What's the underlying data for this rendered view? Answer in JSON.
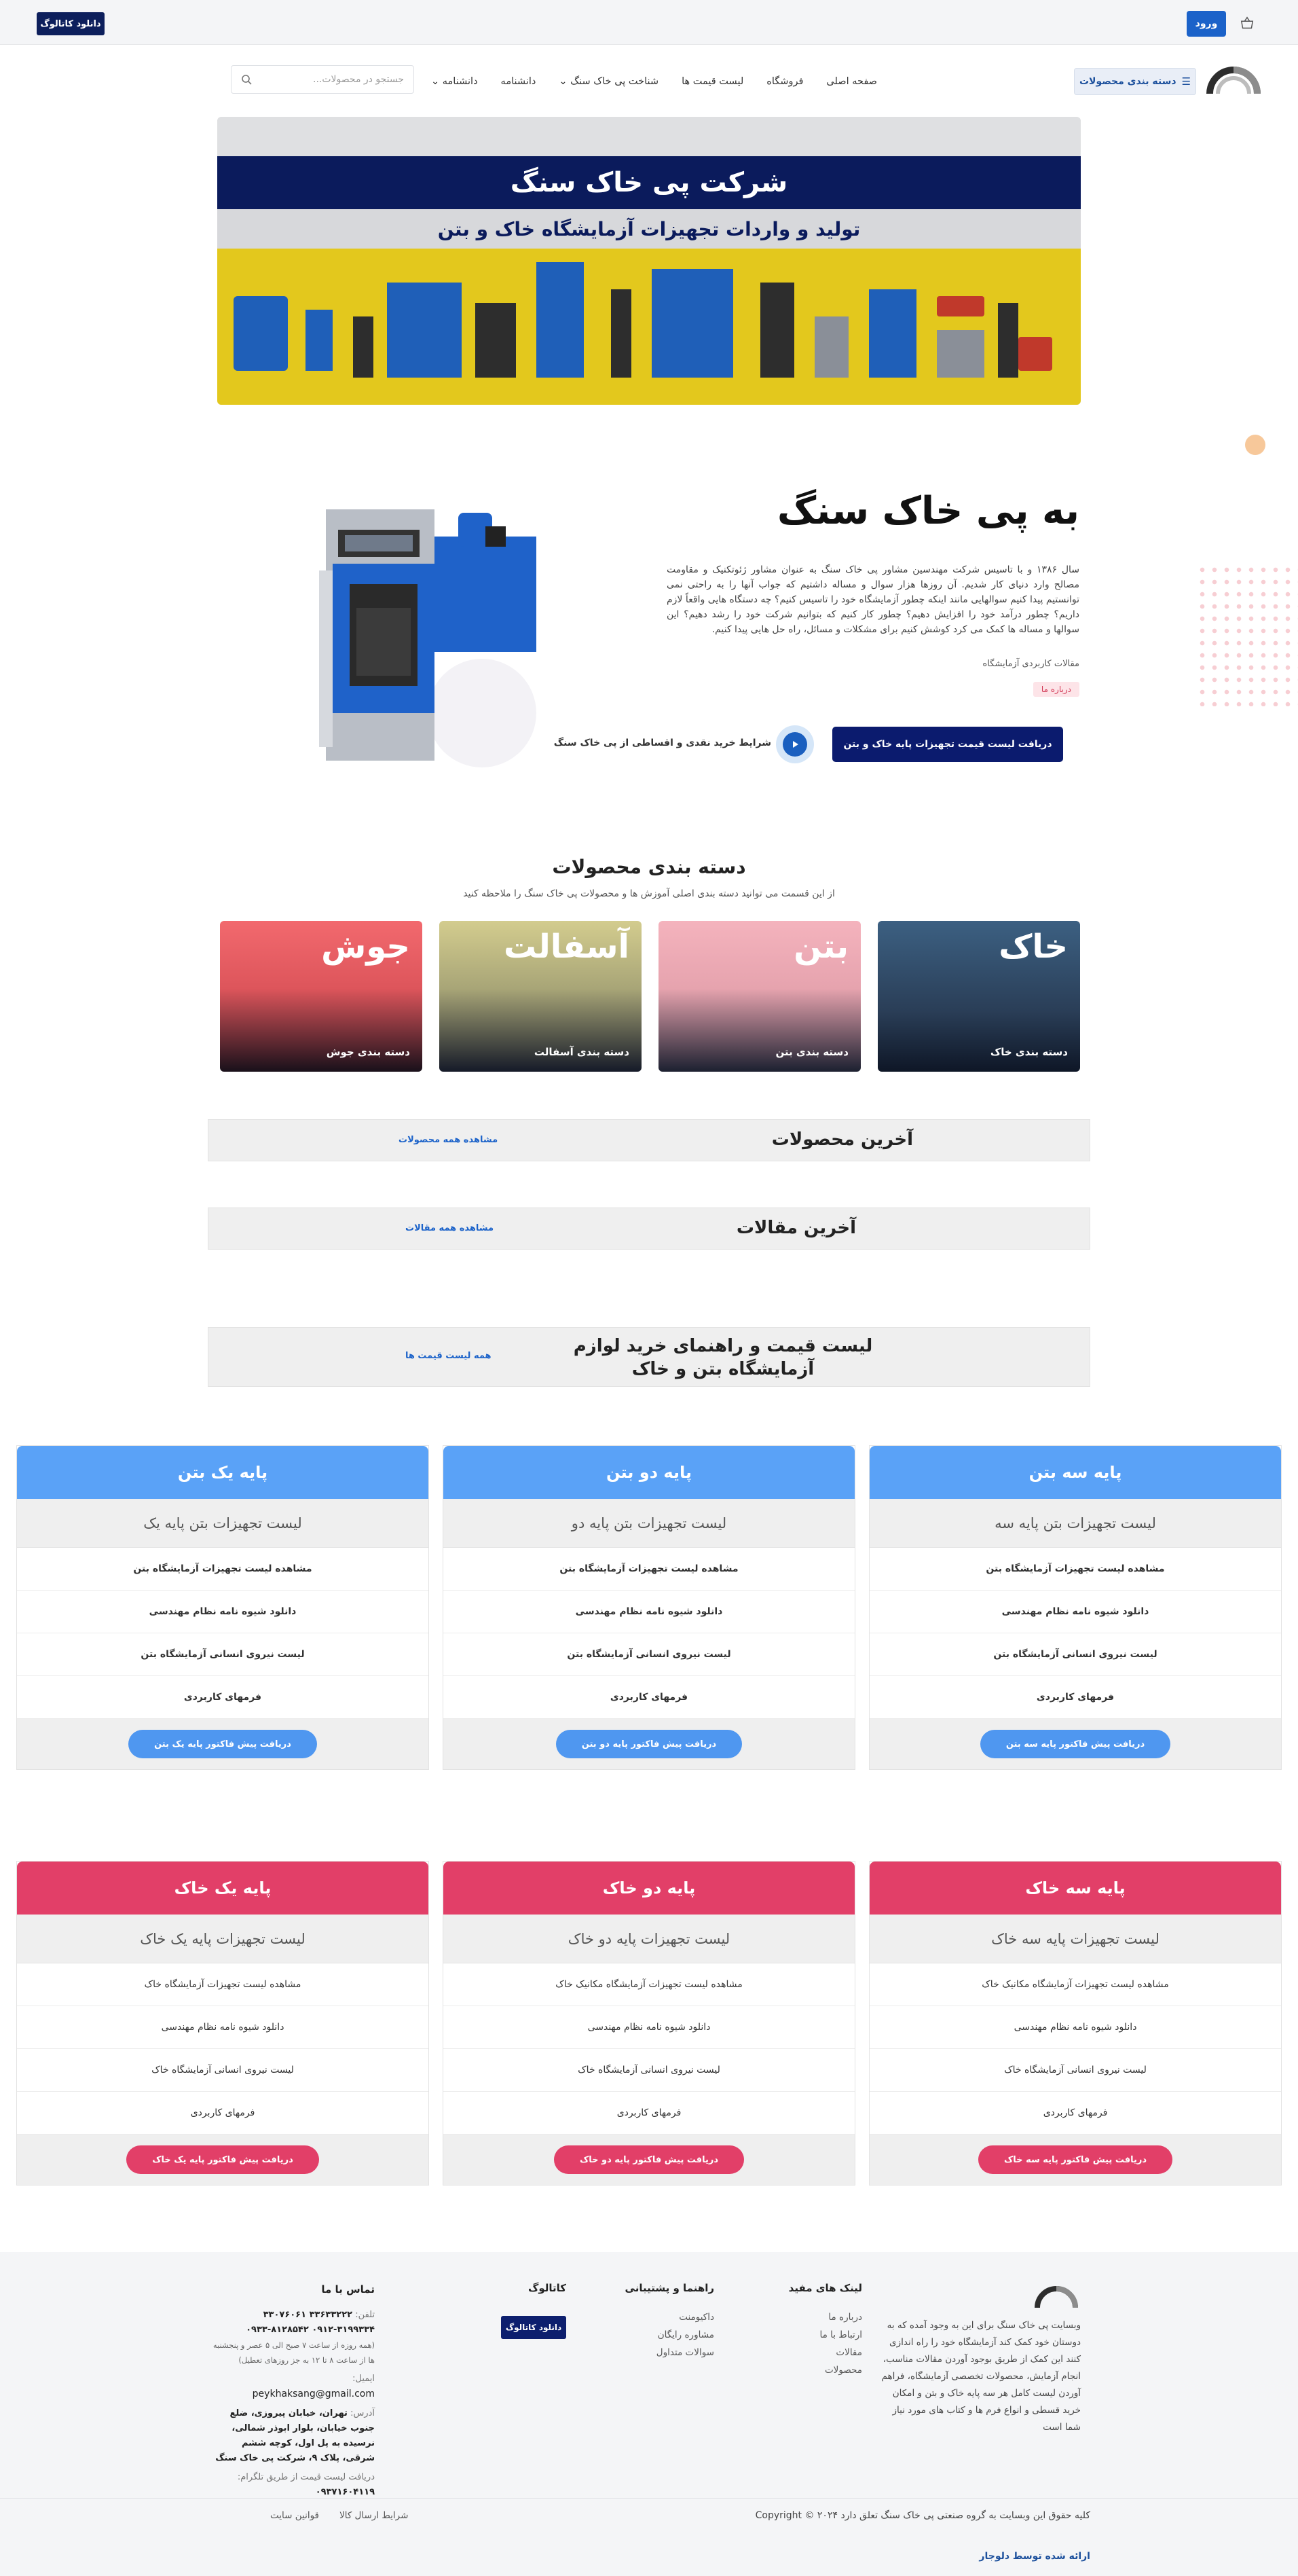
{
  "topbar": {
    "catalog_button": "دانلود کاتالوگ",
    "login_button": "ورود"
  },
  "nav": {
    "categories_button": "دسته بندی محصولات",
    "menu": [
      "صفحه اصلی",
      "فروشگاه",
      "لیست قیمت ها",
      "شناخت پی خاک سنگ",
      "دانشنامه",
      "دانشنامه"
    ],
    "search_placeholder": "جستجو در محصولات..."
  },
  "banner": {
    "title": "شرکت پی خاک سنگ",
    "subtitle": "تولید و واردات تجهیزات آزمایشگاه خاک و بتن"
  },
  "about": {
    "title": "به پی خاک سنگ",
    "text": "سال ۱۳۸۶ و با تاسیس شرکت مهندسین مشاور پی خاک سنگ به عنوان مشاور ژئوتکنیک و مقاومت مصالح وارد دنیای کار شدیم. آن روزها هزار سوال و مساله داشتیم که جواب آنها را به راحتی نمی توانستیم پیدا کنیم سوالهایی مانند اینکه چطور آزمایشگاه خود را تاسیس کنیم؟ چه دستگاه هایی واقعاً لازم داریم؟ چطور درآمد خود را افزایش دهیم؟ چطور کار کنیم که بتوانیم شرکت خود را رشد دهیم؟ این سوالها و مساله ها کمک می کرد کوشش کنیم برای مشکلات و مسائل، راه حل هایی پیدا کنیم.",
    "link": "مقالات کاربردی آزمایشگاه",
    "badge": "درباره ما",
    "price_button": "دریافت لیست قیمت تجهیزات پایه خاک و بتن",
    "terms_text": "شرایط خرید نقدی و اقساطی از پی خاک سنگ"
  },
  "categories": {
    "title": "دسته بندی محصولات",
    "subtitle": "از این قسمت می توانید دسته بندی اصلی آموزش ها و محصولات پی خاک سنگ را ملاحظه کنید",
    "items": [
      {
        "big": "خاک",
        "small": "دسته بندی خاک",
        "color": "#2f5274"
      },
      {
        "big": "بتن",
        "small": "دسته بندی بتن",
        "color": "#f0a7b2"
      },
      {
        "big": "آسفالت",
        "small": "دسته بندی آسفالت",
        "color": "#c8c187"
      },
      {
        "big": "جوش",
        "small": "دسته بندی جوش",
        "color": "#ef5a61"
      }
    ]
  },
  "latest_products": {
    "title": "آخرین محصولات",
    "link": "مشاهده همه محصولات"
  },
  "latest_articles": {
    "title": "آخرین مقالات",
    "link": "مشاهده همه مقالات"
  },
  "price_list": {
    "title": "لیست قیمت و راهنمای خرید لوازم آزمایشگاه بتن و خاک",
    "link": "همه لیست قیمت ها"
  },
  "concrete_tables": [
    {
      "title": "پایه سه بتن",
      "subtitle": "لیست تجهیزات بتن پایه سه",
      "rows": [
        "مشاهده لیست تجهیزات آزمایشگاه بتن",
        "دانلود شیوه نامه نظام مهندسی",
        "لیست نیروی انسانی آزمایشگاه بتن",
        "فرمهای کاربردی"
      ],
      "button": "دریافت پیش فاکتور پایه سه بتن"
    },
    {
      "title": "پایه دو بتن",
      "subtitle": "لیست تجهیزات بتن پایه دو",
      "rows": [
        "مشاهده لیست تجهیزات آزمایشگاه بتن",
        "دانلود شیوه نامه نظام مهندسی",
        "لیست نیروی انسانی آزمایشگاه بتن",
        "فرمهای کاربردی"
      ],
      "button": "دریافت پیش فاکتور پایه دو بتن"
    },
    {
      "title": "پایه یک بتن",
      "subtitle": "لیست تجهیزات بتن پایه یک",
      "rows": [
        "مشاهده لیست تجهیزات آزمایشگاه بتن",
        "دانلود شیوه نامه نظام مهندسی",
        "لیست نیروی انسانی آزمایشگاه بتن",
        "فرمهای کاربردی"
      ],
      "button": "دریافت پیش فاکتور پایه یک بتن"
    }
  ],
  "soil_tables": [
    {
      "title": "پایه سه خاک",
      "subtitle": "لیست تجهیزات پایه سه خاک",
      "rows": [
        "مشاهده لیست تجهیزات آزمایشگاه مکانیک خاک",
        "دانلود شیوه نامه نظام مهندسی",
        "لیست نیروی انسانی آزمایشگاه خاک",
        "فرمهای کاربردی"
      ],
      "button": "دریافت پیش فاکتور پایه سه خاک"
    },
    {
      "title": "پایه دو خاک",
      "subtitle": "لیست تجهیزات پایه دو خاک",
      "rows": [
        "مشاهده لیست تجهیزات آزمایشگاه مکانیک خاک",
        "دانلود شیوه نامه نظام مهندسی",
        "لیست نیروی انسانی آزمایشگاه خاک",
        "فرمهای کاربردی"
      ],
      "button": "دریافت پیش فاکتور پایه دو خاک"
    },
    {
      "title": "پایه یک خاک",
      "subtitle": "لیست تجهیزات پایه یک خاک",
      "rows": [
        "مشاهده لیست تجهیزات آزمایشگاه خاک",
        "دانلود شیوه نامه نظام مهندسی",
        "لیست نیروی انسانی آزمایشگاه خاک",
        "فرمهای کاربردی"
      ],
      "button": "دریافت پیش فاکتور پایه یک خاک"
    }
  ],
  "footer": {
    "about": "وبسایت پی خاک سنگ برای این به وجود آمده که به دوستان خود کمک کند آزمایشگاه خود را راه اندازی کنند این کمک از طریق بوجود آوردن مقالات مناسب، انجام آزمایش، محصولات تخصصی آزمایشگاه، فراهم آوردن لیست کامل هر سه پایه خاک و بتن و امکان خرید قسطی و انواع فرم ها و کتاب های مورد نیاز شما است",
    "useful_links": {
      "title": "لینک های مفید",
      "items": [
        "درباره ما",
        "ارتباط با ما",
        "مقالات",
        "محصولات"
      ]
    },
    "guide": {
      "title": "راهنما و پشتیبانی",
      "items": [
        "داکیومنت",
        "مشاوره رایگان",
        "سوالات متداول"
      ]
    },
    "catalog": {
      "title": "کاتالوگ",
      "button": "دانلود کاتالوگ"
    },
    "contact": {
      "title": "تماس با ما",
      "phone_label": "تلفن:",
      "phone": "۳۳۶۳۳۲۲۲ ۳۳۰۷۶۰۶۱",
      "mobile": "۰۹۱۲-۳۱۹۹۳۳۴ ۰۹۳۳-۸۱۲۸۵۴۲",
      "hours": "(همه روزه از ساعت ۷ صبح الی ۵ عصر و پنجشنبه ها از ساعت ۸ تا ۱۲ به جز روزهای تعطیل)",
      "email_label": "ایمیل:",
      "email": "peykhaksang@gmail.com",
      "address_label": "آدرس:",
      "address": "تهران، خیابان پیروزی، ضلع جنوب خیابان، بلوار ابوذر شمالی، نرسیده به پل اول، کوچه ششم شرقی، پلاک ۹، شرکت پی خاک سنگ",
      "telegram_label": "دریافت لیست قیمت از طریق تلگرام:",
      "telegram": "۰۹۳۷۱۶۰۴۱۱۹"
    },
    "copyright": "کلیه حقوق این وبسایت به گروه صنعتی پی خاک سنگ تعلق دارد Copyright © ۲۰۲۴",
    "bottom_links": [
      "شرایط ارسال کالا",
      "قوانین سایت"
    ],
    "credit": "ارائه شده توسط دلوجار"
  }
}
